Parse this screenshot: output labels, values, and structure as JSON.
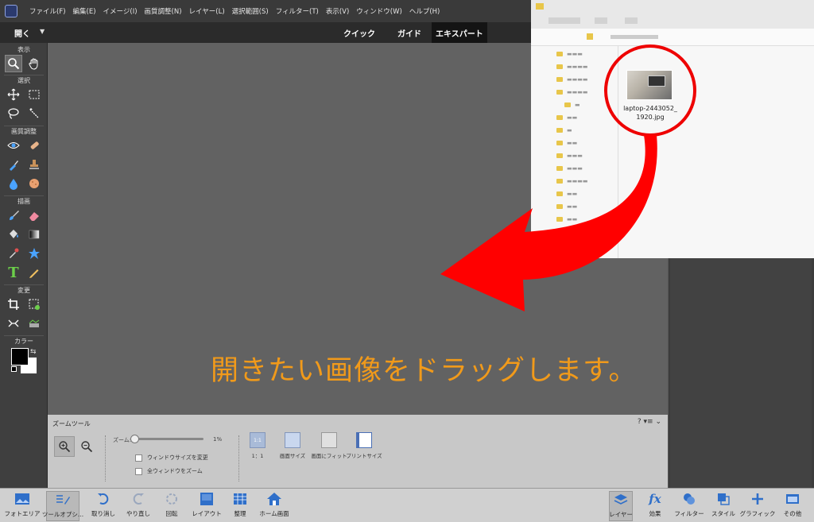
{
  "menubar": {
    "items": [
      "ファイル(F)",
      "編集(E)",
      "イメージ(I)",
      "画質調整(N)",
      "レイヤー(L)",
      "選択範囲(S)",
      "フィルター(T)",
      "表示(V)",
      "ウィンドウ(W)",
      "ヘルプ(H)"
    ]
  },
  "modebar": {
    "open_label": "開く",
    "modes": [
      "クイック",
      "ガイド",
      "エキスパート"
    ],
    "active_mode": "エキスパート"
  },
  "toolbox": {
    "sections": {
      "view": "表示",
      "select": "選択",
      "enhance": "画質調整",
      "draw": "描画",
      "modify": "変更",
      "color": "カラー"
    }
  },
  "explorer": {
    "file_name_line1": "laptop-2443052_",
    "file_name_line2": "1920.jpg"
  },
  "caption": "開きたい画像をドラッグします。",
  "options_panel": {
    "title": "ズームツール",
    "zoom_label": "ズーム:",
    "zoom_value": "1%",
    "checkbox_resize": "ウィンドウサイズを変更",
    "checkbox_all": "全ウィンドウをズーム",
    "view_buttons": [
      "1：1",
      "画面サイズ",
      "画面にフィット",
      "プリントサイズ"
    ],
    "one_to_one_icon": "1:1"
  },
  "bottombar": {
    "left": [
      "フォトエリア",
      "ツールオプシ...",
      "取り消し",
      "やり直し",
      "回転",
      "レイアウト",
      "整理",
      "ホーム画面"
    ],
    "right": [
      "レイヤー",
      "効果",
      "フィルター",
      "スタイル",
      "グラフィック",
      "その他"
    ]
  },
  "colors": {
    "accent_arrow": "#e00000",
    "caption": "#f19a1a"
  }
}
